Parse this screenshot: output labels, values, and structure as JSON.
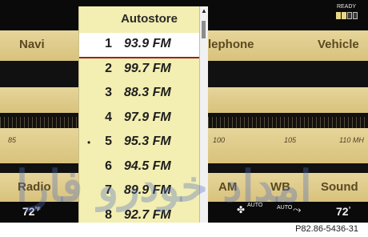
{
  "status": {
    "ready_label": "READY"
  },
  "menu": {
    "items": [
      "Navi",
      "lephone",
      "Vehicle"
    ]
  },
  "scale": {
    "labels": [
      "85",
      "100",
      "105",
      "110 MH"
    ]
  },
  "bottom_menu": {
    "items": [
      "Radio",
      "AM",
      "WB",
      "Sound"
    ]
  },
  "climate": {
    "left_temp": "72",
    "left_unit": "°F",
    "fan_auto": "AUTO",
    "air_auto": "AUTO",
    "right_temp": "72",
    "right_unit": "°"
  },
  "list": {
    "title": "Autostore",
    "selected_index": 0,
    "current_index": 4,
    "items": [
      {
        "num": "1",
        "freq": "93.9 FM"
      },
      {
        "num": "2",
        "freq": "99.7 FM"
      },
      {
        "num": "3",
        "freq": "88.3 FM"
      },
      {
        "num": "4",
        "freq": "97.9 FM"
      },
      {
        "num": "5",
        "freq": "95.3 FM"
      },
      {
        "num": "6",
        "freq": "94.5 FM"
      },
      {
        "num": "7",
        "freq": "89.9 FM"
      },
      {
        "num": "8",
        "freq": "92.7 FM"
      }
    ]
  },
  "caption": "P82.86-5436-31",
  "watermark": "امداد خودرو فارا"
}
